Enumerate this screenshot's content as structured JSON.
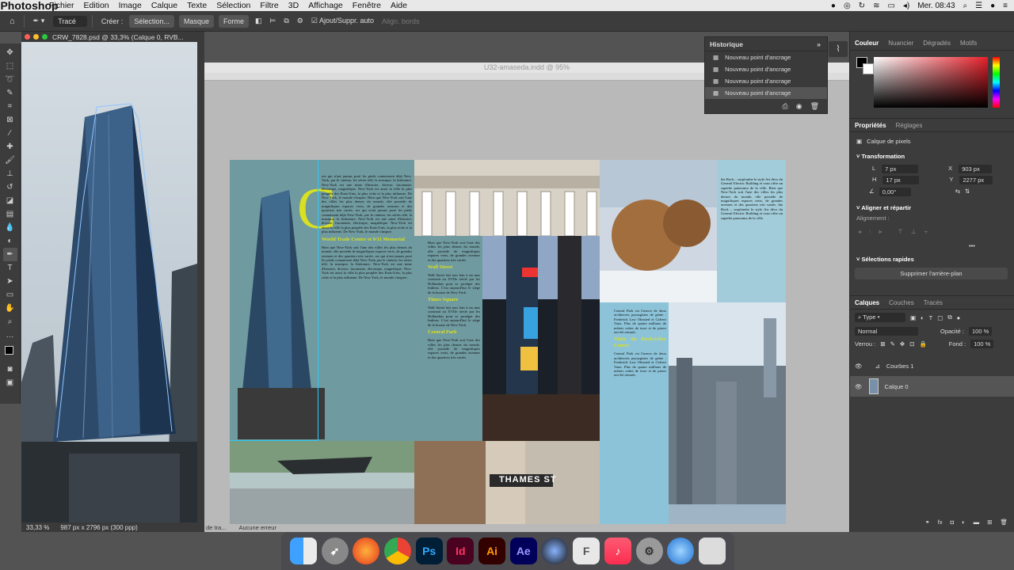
{
  "menubar": {
    "app": "Photoshop",
    "items": [
      "Fichier",
      "Edition",
      "Image",
      "Calque",
      "Texte",
      "Sélection",
      "Filtre",
      "3D",
      "Affichage",
      "Fenêtre",
      "Aide"
    ],
    "clock": "Mer. 08:43"
  },
  "options": {
    "mode": "Tracé",
    "create_label": "Créer :",
    "selection_btn": "Sélection...",
    "mask_btn": "Masque",
    "shape_btn": "Forme",
    "auto_add": "Ajout/Suppr. auto",
    "align_edges": "Align. bords"
  },
  "psdoc": {
    "tab": "CRW_7828.psd @ 33,3% (Calque 0, RVB...",
    "zoom": "33,33 %",
    "size": "987 px x 2796 px (300 ppp)"
  },
  "indesign": {
    "title": "U32-amaseda.indd @ 95%",
    "status_left": "de tra...",
    "status_right": "Aucune erreur",
    "headings": [
      "Wall Street",
      "Times Square",
      "Central Park",
      "World Trade Center et 9/11 Memorial",
      "Visite du Rockefeller Center"
    ],
    "street_sign": "THAMES ST",
    "col1": "rez qui n'ont jamais posé les pieds connaissent déjà New-York, par le cinéma, les séries télé, la musique, la littérature. New-York est une mine d'histoire, diverse, fascinante, électrique, magnétique. New-York est aussi la ville la plus peuplée des Etats-Unis, la plus riche et la plus influente. De New York, le monde s'inspire.",
    "col2": "Bien que New-York soit l'une des villes les plus denses du monde, elle possède de magnifiques espaces verts, de grandes avenues et des quartiers très variés.",
    "col3": "Wall Street fait non loin à un mur construit au XVIIe siècle par les Hollandais pour se protéger des Indiens. C'est aujourd'hui le siège de la bourse de New-York.",
    "col4": "Central Park est l'œuvre de deux architectes paysagistes de génie : Frederick Law Olmsted et Calvert Vaux. Plus de quatre millions de mètres cubes de terre et de pierre ont été remués.",
    "col5": "the Rock – surplombe le style Art déco du General Electric Building et vous offre un superbe panorama de la ville."
  },
  "history": {
    "title": "Historique",
    "items": [
      "Nouveau point d'ancrage",
      "Nouveau point d'ancrage",
      "Nouveau point d'ancrage",
      "Nouveau point d'ancrage"
    ]
  },
  "color_panel": {
    "tabs": [
      "Couleur",
      "Nuancier",
      "Dégradés",
      "Motifs"
    ]
  },
  "properties": {
    "tabs": [
      "Propriétés",
      "Réglages"
    ],
    "pixel_layer": "Calque de pixels",
    "transform": "Transformation",
    "L": "7 px",
    "X": "903 px",
    "H": "17 px",
    "Y": "2277 px",
    "angle": "0,00°",
    "align_title": "Aligner et répartir",
    "align_label": "Alignement :",
    "quick_title": "Sélections rapides",
    "remove_bg": "Supprimer l'arrière-plan"
  },
  "layers": {
    "tabs": [
      "Calques",
      "Couches",
      "Tracés"
    ],
    "filter": "Type",
    "blend": "Normal",
    "opacity_label": "Opacité :",
    "opacity": "100 %",
    "lock_label": "Verrou :",
    "fill_label": "Fond :",
    "fill": "100 %",
    "items": [
      "Courbes 1",
      "Calque 0"
    ]
  },
  "dock": [
    "Finder",
    "Launchpad",
    "Firefox",
    "Chrome",
    "Ps",
    "Id",
    "Ai",
    "Ae",
    "Cinema 4D",
    "Preview",
    "Music",
    "System Preferences",
    "Network",
    "Trash"
  ]
}
